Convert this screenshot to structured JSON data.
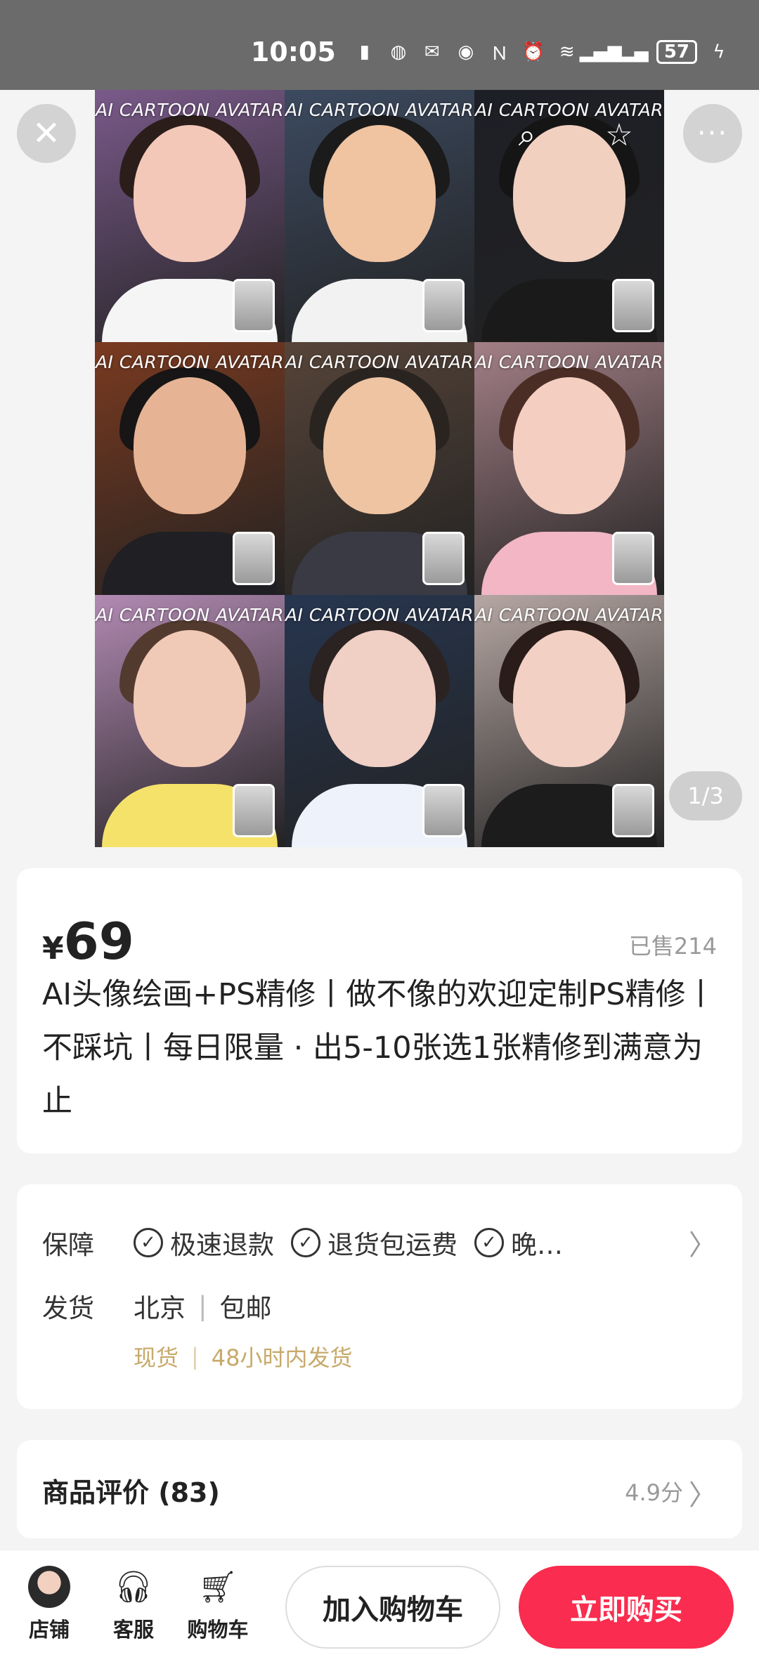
{
  "status_bar": {
    "time": "10:05",
    "battery": "57"
  },
  "hero": {
    "tile_caption": "AI CARTOON AVATAR",
    "pager": "1/3",
    "tiles": [
      {
        "bg": "#7a5a8a",
        "hair": "#2b1d1a",
        "skin": "#f3c8b8",
        "shirt": "#f5f5f5"
      },
      {
        "bg": "#3c4a60",
        "hair": "#1b1b1b",
        "skin": "#f0c3a1",
        "shirt": "#f2f2f2"
      },
      {
        "bg": "#1d1f26",
        "hair": "#151515",
        "skin": "#f1d0c0",
        "shirt": "#1a1a1a"
      },
      {
        "bg": "#7a3a20",
        "hair": "#171515",
        "skin": "#e6b494",
        "shirt": "#1f1f24"
      },
      {
        "bg": "#564439",
        "hair": "#2a2421",
        "skin": "#eec4a3",
        "shirt": "#3a3a44"
      },
      {
        "bg": "#a27f86",
        "hair": "#4a2e25",
        "skin": "#f4cfc1",
        "shirt": "#f2b6c4"
      },
      {
        "bg": "#b28ab3",
        "hair": "#523a2e",
        "skin": "#f1c9b7",
        "shirt": "#f5e26a"
      },
      {
        "bg": "#273650",
        "hair": "#2b2222",
        "skin": "#f0cfc4",
        "shirt": "#eef2fb"
      },
      {
        "bg": "#b6a7a3",
        "hair": "#2a1c18",
        "skin": "#f2d0c3",
        "shirt": "#1c1c1c"
      }
    ]
  },
  "product": {
    "currency": "¥",
    "price": "69",
    "sold": "已售214",
    "title": "AI头像绘画+PS精修丨做不像的欢迎定制PS精修丨不踩坑丨每日限量 · 出5-10张选1张精修到满意为止"
  },
  "service": {
    "guarantee_label": "保障",
    "guarantees": [
      "极速退款",
      "退货包运费",
      "晚…"
    ],
    "ship_label": "发货",
    "ship_from": "北京",
    "ship_fee": "包邮",
    "stock": "现货",
    "ship_time": "48小时内发货"
  },
  "review": {
    "title": "商品评价 (83)",
    "rating": "4.9分"
  },
  "bottom": {
    "store": "店铺",
    "service": "客服",
    "cart": "购物车",
    "add_to_cart": "加入购物车",
    "buy_now": "立即购买"
  },
  "colors": {
    "accent": "#fa2c4f",
    "gold": "#c7a96a"
  }
}
